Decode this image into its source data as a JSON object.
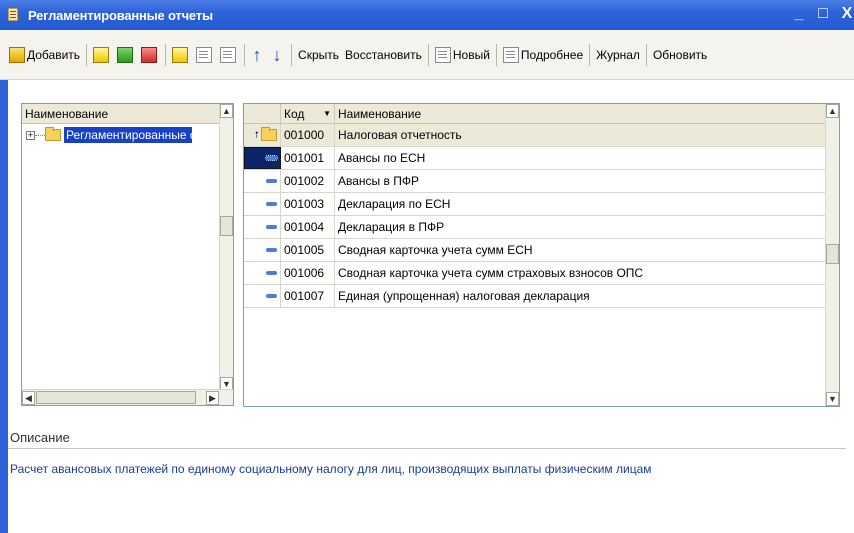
{
  "window": {
    "title": "Регламентированные отчеты",
    "controls": [
      "_",
      "□",
      "X"
    ]
  },
  "toolbar": {
    "add_label": "Добавить",
    "hide_label": "Скрыть",
    "restore_label": "Восстановить",
    "new_label": "Новый",
    "details_label": "Подробнее",
    "journal_label": "Журнал",
    "refresh_label": "Обновить"
  },
  "tree": {
    "header": "Наименование",
    "root_label": "Регламентированные отчеты"
  },
  "grid": {
    "col_code": "Код",
    "col_name": "Наименование",
    "sort_indicator": "▼",
    "rows": [
      {
        "code": "001000",
        "name": "Налоговая отчетность",
        "type": "folder"
      },
      {
        "code": "001001",
        "name": "Авансы по ЕСН",
        "type": "item",
        "selected": true
      },
      {
        "code": "001002",
        "name": "Авансы в ПФР",
        "type": "item"
      },
      {
        "code": "001003",
        "name": "Декларация по ЕСН",
        "type": "item"
      },
      {
        "code": "001004",
        "name": "Декларация в ПФР",
        "type": "item"
      },
      {
        "code": "001005",
        "name": "Сводная карточка учета сумм ЕСН",
        "type": "item"
      },
      {
        "code": "001006",
        "name": "Сводная карточка учета сумм страховых взносов ОПС",
        "type": "item"
      },
      {
        "code": "001007",
        "name": "Единая (упрощенная) налоговая декларация",
        "type": "item"
      }
    ]
  },
  "description": {
    "title": "Описание",
    "text": "Расчет авансовых платежей по единому социальному налогу для лиц, производящих выплаты физическим лицам"
  },
  "colors": {
    "titlebar": "#245ad3",
    "selection": "#1841c8",
    "description_text": "#1a3b9c"
  }
}
